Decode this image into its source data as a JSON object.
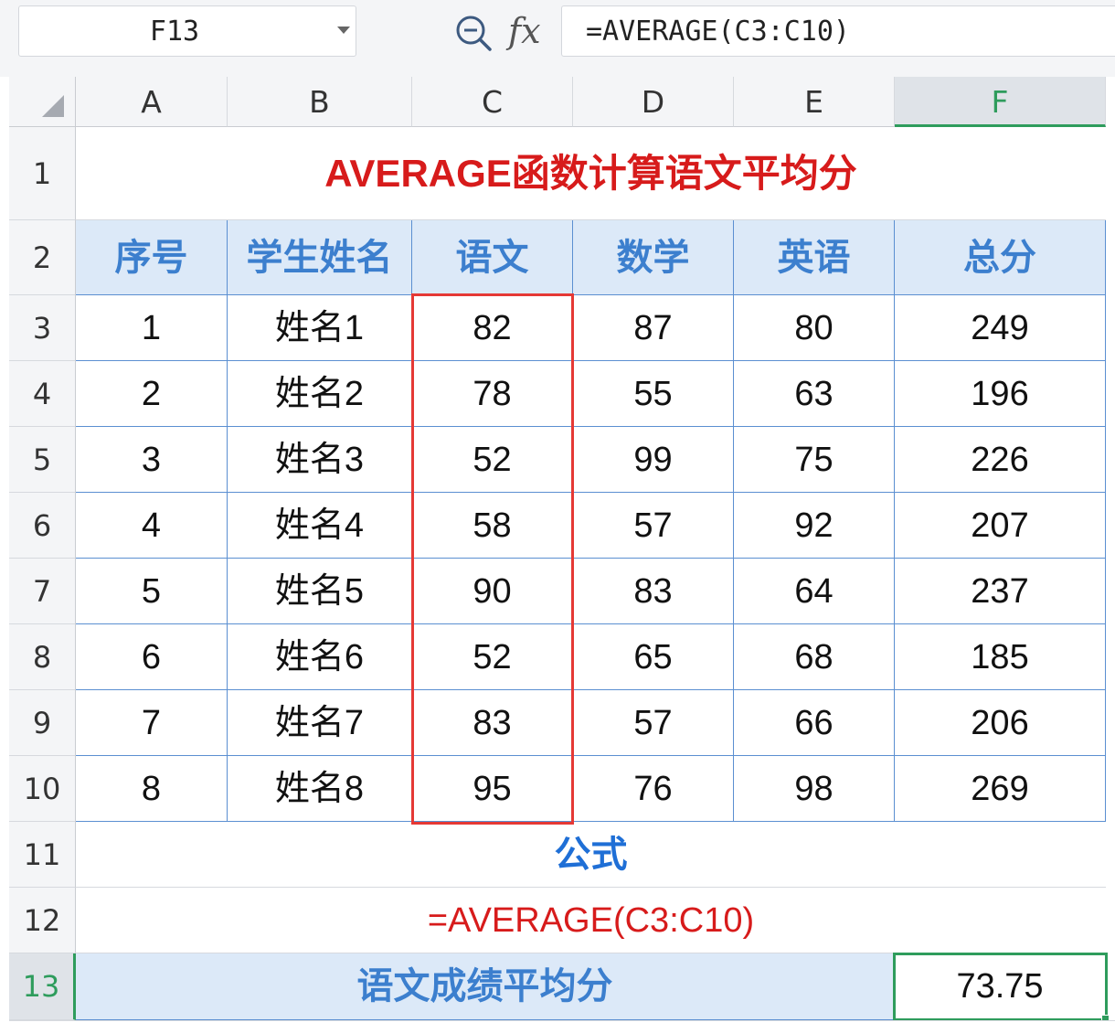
{
  "name_box": {
    "value": "F13"
  },
  "formula_bar": {
    "fx_label": "fx",
    "formula": "=AVERAGE(C3:C10)"
  },
  "columns": [
    "A",
    "B",
    "C",
    "D",
    "E",
    "F"
  ],
  "rows": [
    "1",
    "2",
    "3",
    "4",
    "5",
    "6",
    "7",
    "8",
    "9",
    "10",
    "11",
    "12",
    "13"
  ],
  "active_cell": "F13",
  "sheet": {
    "title": "AVERAGE函数计算语文平均分",
    "headers": [
      "序号",
      "学生姓名",
      "语文",
      "数学",
      "英语",
      "总分"
    ],
    "data_rows": [
      [
        "1",
        "姓名1",
        "82",
        "87",
        "80",
        "249"
      ],
      [
        "2",
        "姓名2",
        "78",
        "55",
        "63",
        "196"
      ],
      [
        "3",
        "姓名3",
        "52",
        "99",
        "75",
        "226"
      ],
      [
        "4",
        "姓名4",
        "58",
        "57",
        "92",
        "207"
      ],
      [
        "5",
        "姓名5",
        "90",
        "83",
        "64",
        "237"
      ],
      [
        "6",
        "姓名6",
        "52",
        "65",
        "68",
        "185"
      ],
      [
        "7",
        "姓名7",
        "83",
        "57",
        "66",
        "206"
      ],
      [
        "8",
        "姓名8",
        "95",
        "76",
        "98",
        "269"
      ]
    ],
    "formula_title": "公式",
    "formula_example": "=AVERAGE(C3:C10)",
    "average_label": "语文成绩平均分",
    "average_value": "73.75"
  },
  "colors": {
    "header_fill": "#dce9f8",
    "header_text": "#3c7fce",
    "title_red": "#d71b1b",
    "formula_blue": "#1f6fd6",
    "highlight_red": "#e53935",
    "active_green": "#2e9c5c",
    "grid_blue": "#5b8fd1"
  }
}
